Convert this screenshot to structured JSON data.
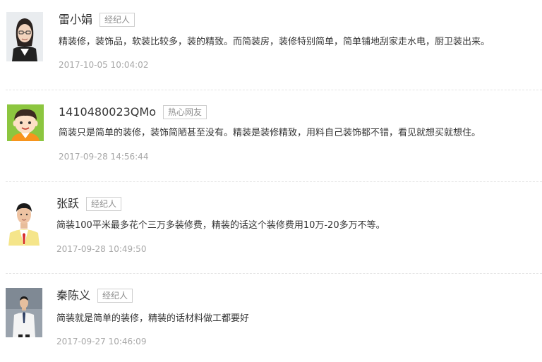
{
  "comments": [
    {
      "name": "雷小娟",
      "badge": "经纪人",
      "text": "精装修，装饰品，软装比较多，装的精致。而简装房，装修特别简单，简单铺地刮家走水电，厨卫装出来。",
      "time": "2017-10-05 10:04:02",
      "avatar": "woman-with-glasses-photo"
    },
    {
      "name": "1410480023QMo",
      "badge": "热心网友",
      "text": "简装只是简单的装修，装饰简陋甚至没有。精装是装修精致，用料自己装饰都不错，看见就想买就想住。",
      "time": "2017-09-28 14:56:44",
      "avatar": "cartoon-boy-avatar"
    },
    {
      "name": "张跃",
      "badge": "经纪人",
      "text": "简装100平米最多花个三万多装修费，精装的话这个装修费用10万-20多万不等。",
      "time": "2017-09-28 10:49:50",
      "avatar": "man-yellow-vest-photo"
    },
    {
      "name": "秦陈义",
      "badge": "经纪人",
      "text": "简装就是简单的装修，精装的话材料做工都要好",
      "time": "2017-09-27 10:46:09",
      "avatar": "man-white-shirt-photo"
    }
  ]
}
